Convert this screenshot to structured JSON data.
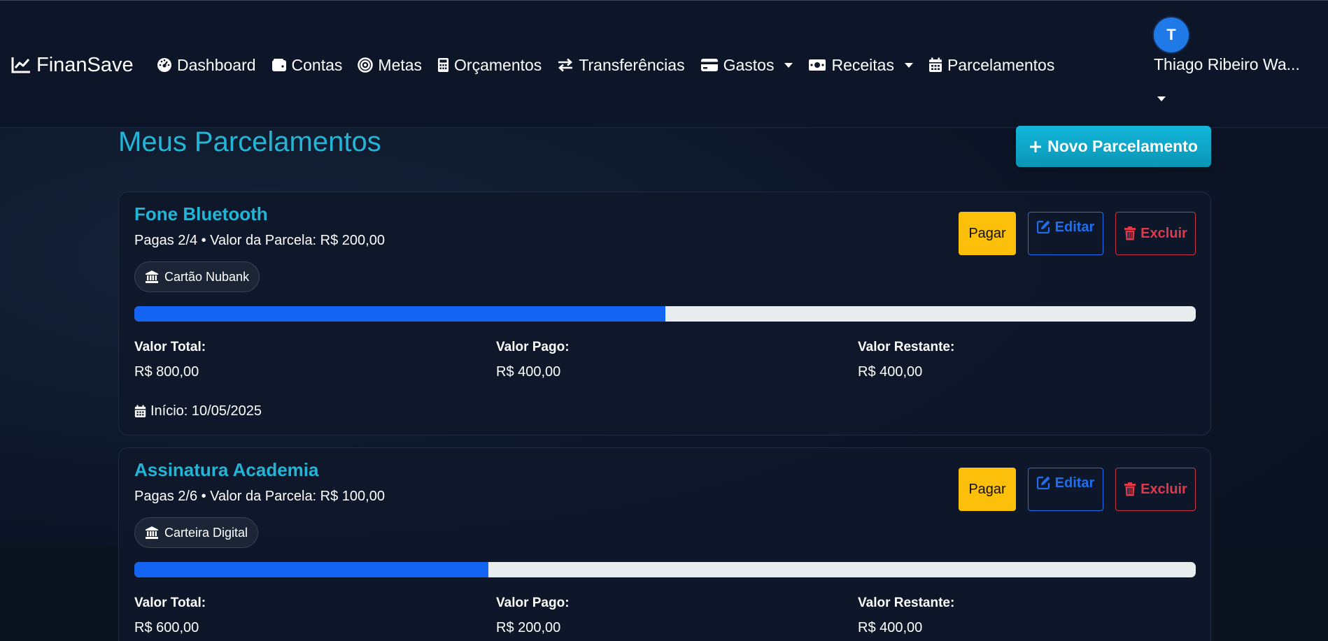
{
  "brand": {
    "name": "FinanSave",
    "icon": "chart-line-icon"
  },
  "nav": [
    {
      "label": "Dashboard",
      "icon": "gauge-icon"
    },
    {
      "label": "Contas",
      "icon": "wallet-icon"
    },
    {
      "label": "Metas",
      "icon": "target-icon"
    },
    {
      "label": "Orçamentos",
      "icon": "calculator-icon"
    },
    {
      "label": "Transferências",
      "icon": "exchange-icon"
    },
    {
      "label": "Gastos",
      "icon": "credit-card-icon",
      "dropdown": true
    },
    {
      "label": "Receitas",
      "icon": "money-bill-icon",
      "dropdown": true
    },
    {
      "label": "Parcelamentos",
      "icon": "calendar-icon"
    }
  ],
  "user": {
    "initial": "T",
    "name": "Thiago Ribeiro Wa..."
  },
  "page": {
    "title": "Meus Parcelamentos",
    "new_button": "Novo Parcelamento"
  },
  "buttons": {
    "pay": "Pagar",
    "edit": "Editar",
    "delete": "Excluir"
  },
  "labels": {
    "total": "Valor Total:",
    "paid": "Valor Pago:",
    "remaining": "Valor Restante:"
  },
  "installments": [
    {
      "title": "Fone Bluetooth",
      "summary": "Pagas 2/4 • Valor da Parcela: R$ 200,00",
      "account": "Cartão Nubank",
      "progress": 0.5,
      "total": "R$ 800,00",
      "paid": "R$ 400,00",
      "remaining": "R$ 400,00",
      "start": "Início: 10/05/2025"
    },
    {
      "title": "Assinatura Academia",
      "summary": "Pagas 2/6 • Valor da Parcela: R$ 100,00",
      "account": "Carteira Digital",
      "progress": 0.3333,
      "total": "R$ 600,00",
      "paid": "R$ 200,00",
      "remaining": "R$ 400,00"
    }
  ],
  "colors": {
    "accent": "#22b5d6",
    "primary": "#1565f5",
    "warning": "#fcc00a",
    "danger": "#e0394b",
    "background": "#0d1528"
  }
}
